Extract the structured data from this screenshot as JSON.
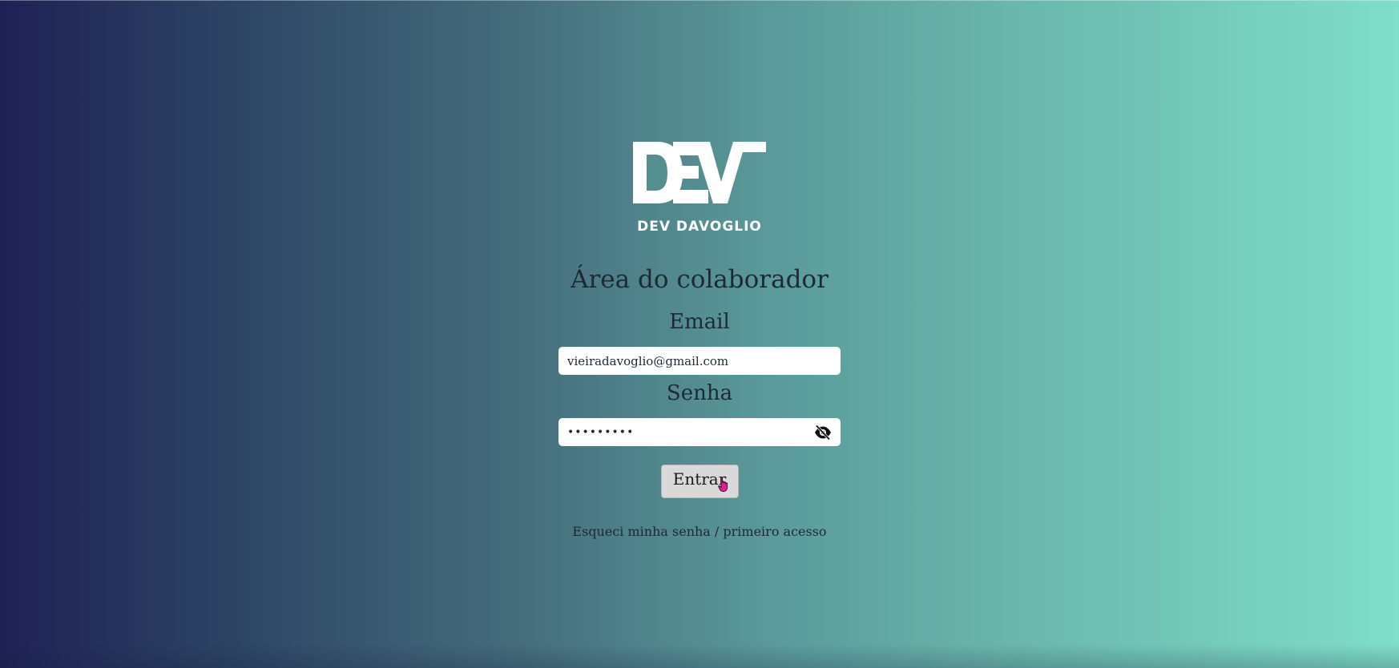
{
  "brand": {
    "logo_mark": "DEV",
    "logo_text": "DEV DAVOGLIO"
  },
  "page": {
    "title": "Área do colaborador"
  },
  "form": {
    "email_label": "Email",
    "email_value": "vieiradavoglio@gmail.com",
    "password_label": "Senha",
    "password_value": "•••••••••",
    "submit_label": "Entrar",
    "forgot_link": "Esqueci minha senha / primeiro acesso"
  },
  "icons": {
    "password_toggle": "eye-slash-icon",
    "cursor": "hand-pointer-icon"
  },
  "colors": {
    "gradient_start": "#1f2154",
    "gradient_end": "#7fdec7",
    "text": "#1e2a33",
    "button_bg": "#d9d9d9",
    "cursor": "#e0219a"
  }
}
